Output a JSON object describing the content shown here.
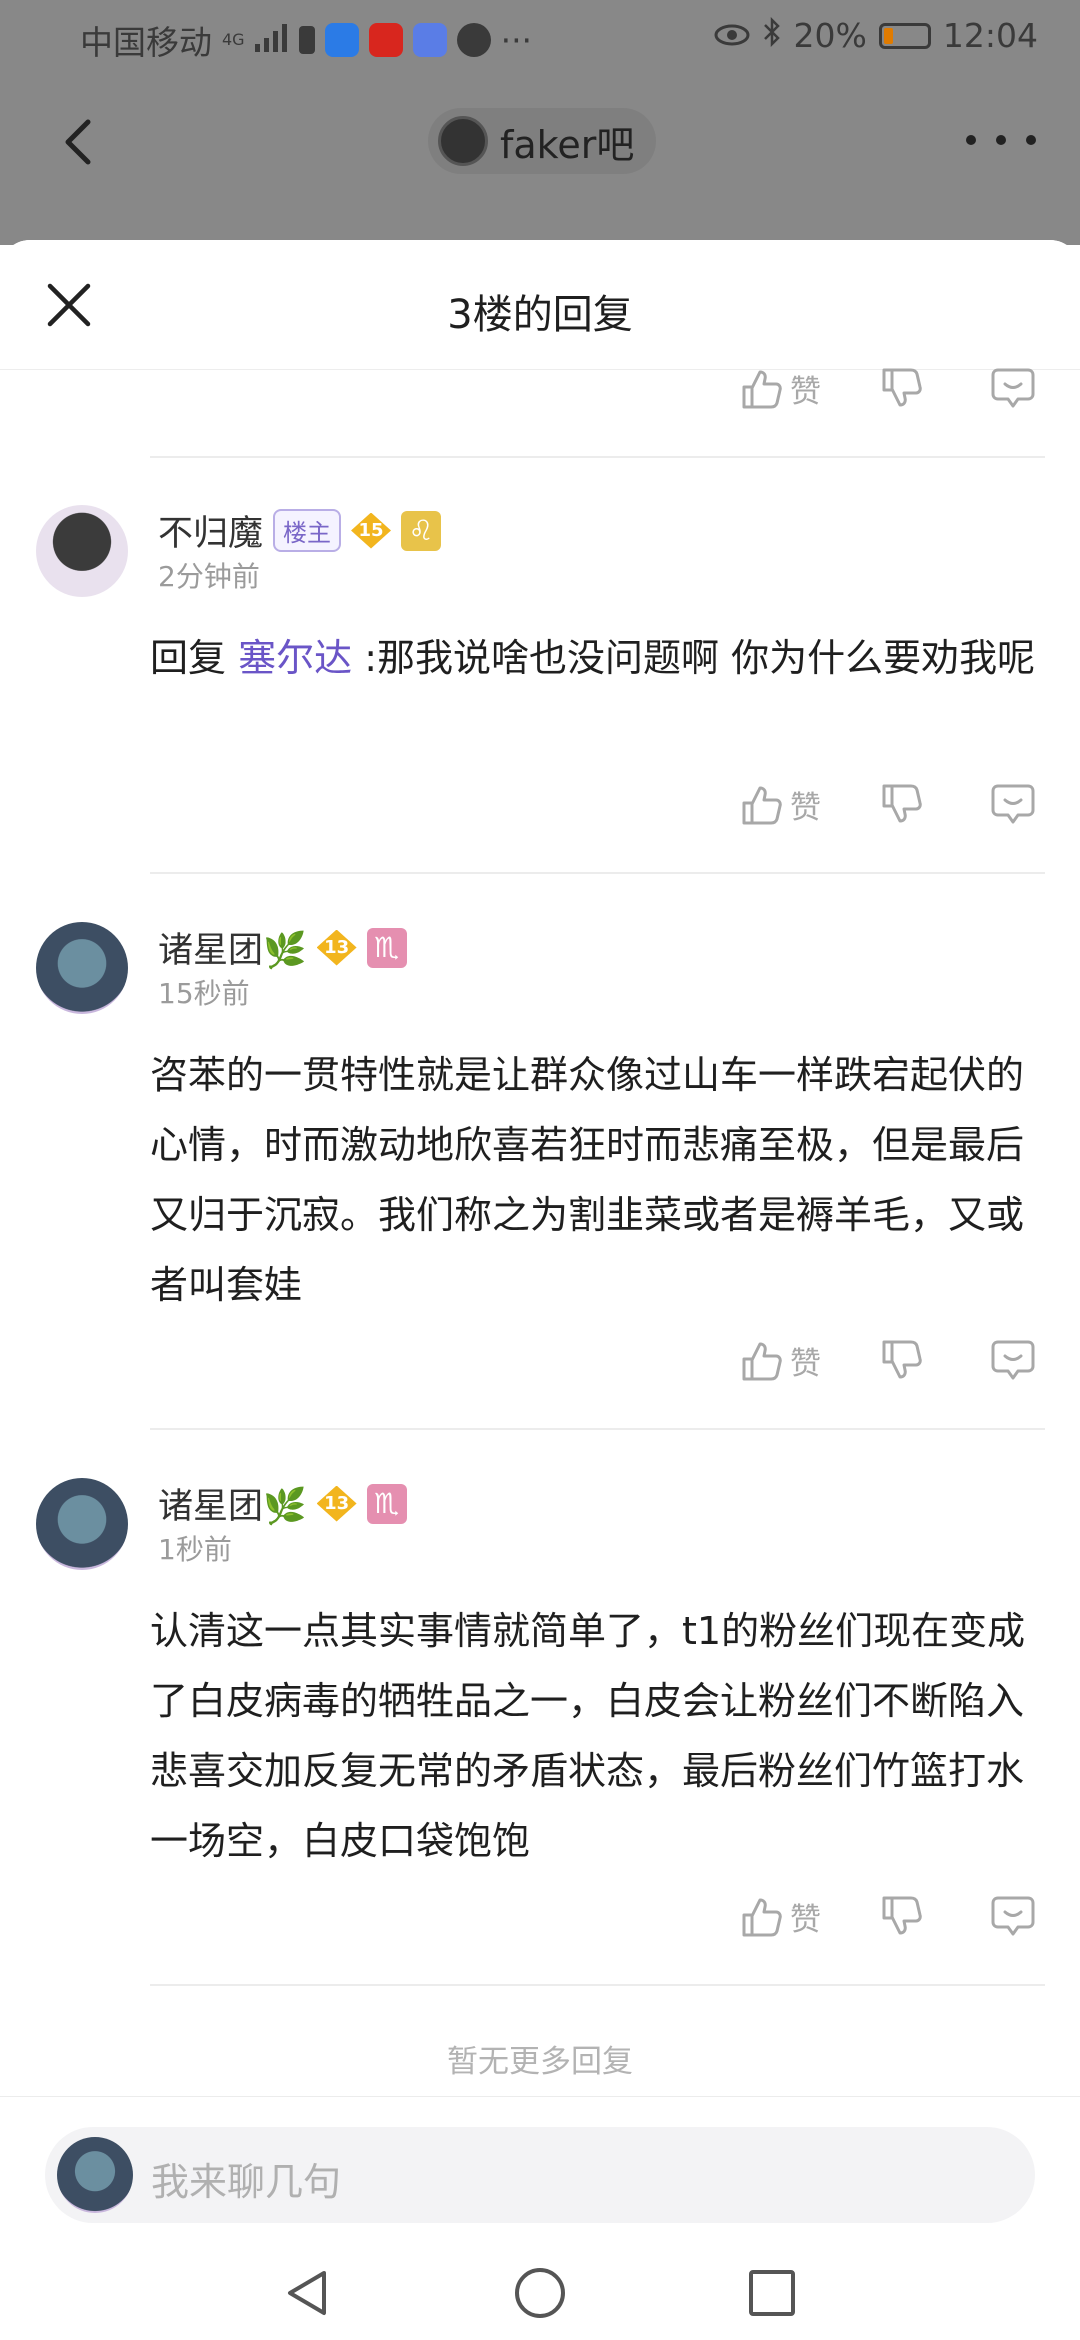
{
  "status_bar": {
    "carrier": "中国移动",
    "network": "4G",
    "battery_percent": "20%",
    "time": "12:04"
  },
  "nav": {
    "forum_name": "faker吧"
  },
  "sheet": {
    "title": "3楼的回复"
  },
  "actions": {
    "like_label": "赞"
  },
  "replies": [
    {
      "username": "不归魔",
      "badge": "楼主",
      "level": "15",
      "time": "2分钟前",
      "prefix": "回复",
      "mention": "塞尔达",
      "content": " :那我说啥也没问题啊 你为什么要劝我呢"
    },
    {
      "username": "诸星团🌿",
      "level": "13",
      "time": "15秒前",
      "content": "咨苯的一贯特性就是让群众像过山车一样跌宕起伏的心情，时而激动地欣喜若狂时而悲痛至极，但是最后又归于沉寂。我们称之为割韭菜或者是褥羊毛，又或者叫套娃"
    },
    {
      "username": "诸星团🌿",
      "level": "13",
      "time": "1秒前",
      "content": "认清这一点其实事情就简单了，t1的粉丝们现在变成了白皮病毒的牺牲品之一，白皮会让粉丝们不断陷入悲喜交加反复无常的矛盾状态，最后粉丝们竹篮打水一场空，白皮口袋饱饱"
    }
  ],
  "no_more": "暂无更多回复",
  "input": {
    "placeholder": "我来聊几句"
  },
  "colors": {
    "accent": "#6a55c7",
    "dim_overlay": "#888888",
    "level_gold": "#f2b51e",
    "zodiac_yellow": "#e8c34a",
    "zodiac_pink": "#e58fb0"
  }
}
